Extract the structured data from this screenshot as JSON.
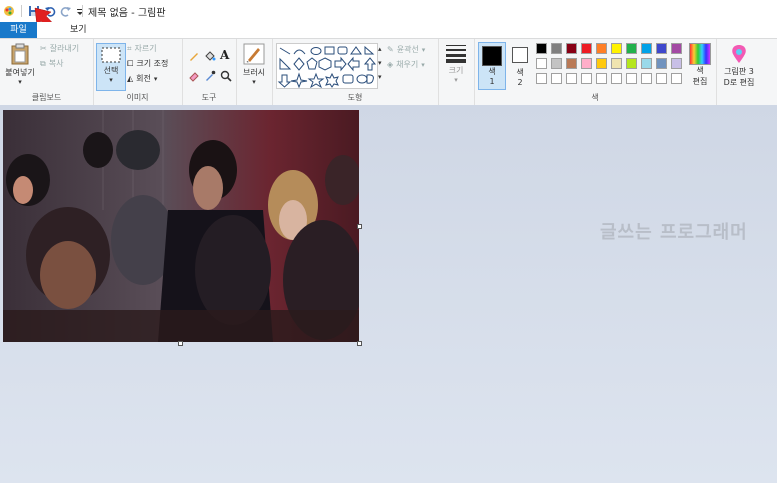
{
  "window": {
    "title": "제목 없음 - 그림판"
  },
  "tabs": {
    "file": "파일",
    "view": "보기"
  },
  "clipboard": {
    "paste": "붙여넣기",
    "cut": "잘라내기",
    "copy": "복사",
    "label": "클립보드"
  },
  "image": {
    "select": "선택",
    "crop": "자르기",
    "resize": "크기 조정",
    "rotate": "회전",
    "label": "이미지"
  },
  "tools": {
    "label": "도구"
  },
  "brushes": {
    "label": "브러시"
  },
  "shapes": {
    "outline": "윤곽선",
    "fill": "채우기",
    "label": "도형"
  },
  "size": {
    "label": "크기"
  },
  "colors": {
    "color1": "색\n1",
    "color1_line1": "색",
    "color1_line2": "1",
    "color2_line1": "색",
    "color2_line2": "2",
    "edit_line1": "색",
    "edit_line2": "편집",
    "label": "색",
    "palette_row1": [
      "#000000",
      "#7f7f7f",
      "#880015",
      "#ed1c24",
      "#ff7f27",
      "#fff200",
      "#22b14c",
      "#00a2e8",
      "#3f48cc",
      "#a349a4"
    ],
    "palette_row2": [
      "#ffffff",
      "#c3c3c3",
      "#b97a57",
      "#ffaec9",
      "#ffc90e",
      "#efe4b0",
      "#b5e61d",
      "#99d9ea",
      "#7092be",
      "#c8bfe7"
    ]
  },
  "paint3d": {
    "line1": "그림판 3",
    "line2": "D로 편집"
  },
  "canvas": {
    "watermark": "글쓰는 프로그래머"
  }
}
